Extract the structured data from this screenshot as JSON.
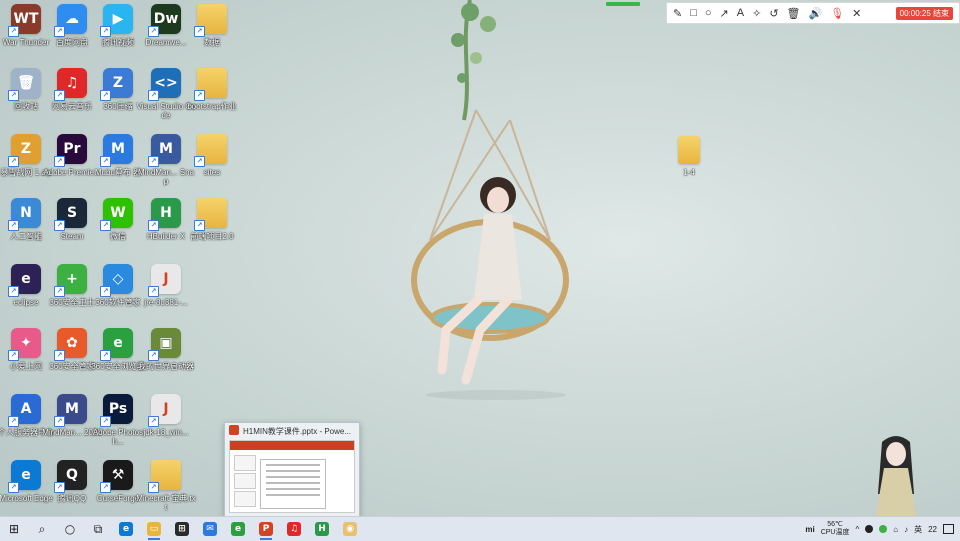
{
  "desktop": {
    "icons": [
      {
        "label": "War Thunder",
        "color": "#8a3a2a",
        "glyph": "WT"
      },
      {
        "label": "百度网盘",
        "color": "#2f8cf0",
        "glyph": "☁"
      },
      {
        "label": "腾讯视频",
        "color": "#2bb5f0",
        "glyph": "▶"
      },
      {
        "label": "Dreamwe...",
        "color": "#1e3a1e",
        "glyph": "Dw"
      },
      {
        "label": "数据",
        "color": "folder",
        "glyph": ""
      },
      {
        "label": "回收站",
        "color": "#9fb3c8",
        "glyph": "🗑"
      },
      {
        "label": "网易云音乐",
        "color": "#e02828",
        "glyph": "♫"
      },
      {
        "label": "360压缩",
        "color": "#3b7bd5",
        "glyph": "Z"
      },
      {
        "label": "Visual Studio Code",
        "color": "#1f6fb8",
        "glyph": "<>"
      },
      {
        "label": "bootstrap作业",
        "color": "folder",
        "glyph": ""
      },
      {
        "label": "暴雪战网 1.zip",
        "color": "#e0a030",
        "glyph": "Z"
      },
      {
        "label": "Adobe Premie...",
        "color": "#2a0a3a",
        "glyph": "Pr"
      },
      {
        "label": "Mubu幕布 器",
        "color": "#2a7ae0",
        "glyph": "M"
      },
      {
        "label": "MindMan... Snap",
        "color": "#3a5aa0",
        "glyph": "M"
      },
      {
        "label": "sites",
        "color": "folder",
        "glyph": ""
      },
      {
        "label": "人工智能",
        "color": "#3a8ad5",
        "glyph": "N"
      },
      {
        "label": "Steam",
        "color": "#1b2838",
        "glyph": "S"
      },
      {
        "label": "微信",
        "color": "#2ec100",
        "glyph": "W"
      },
      {
        "label": "HBuilder X",
        "color": "#2a9a4a",
        "glyph": "H"
      },
      {
        "label": "前端项目2.0",
        "color": "folder",
        "glyph": ""
      },
      {
        "label": "eclipse",
        "color": "#2c2255",
        "glyph": "e"
      },
      {
        "label": "360安全卫士",
        "color": "#3cb043",
        "glyph": "+"
      },
      {
        "label": "360软件管家",
        "color": "#2a8ae0",
        "glyph": "◇"
      },
      {
        "label": "jre-8u381-...",
        "color": "#e8e8e8",
        "glyph": "J"
      },
      {
        "label": "小爱上网",
        "color": "#e85a8a",
        "glyph": "✦"
      },
      {
        "label": "360安全管家",
        "color": "#e85a2a",
        "glyph": "✿"
      },
      {
        "label": "360安全浏览器",
        "color": "#2aa040",
        "glyph": "e"
      },
      {
        "label": "我的世界启动器",
        "color": "#6a8a3a",
        "glyph": "▣"
      },
      {
        "label": "个人服务器中心",
        "color": "#2a6ad5",
        "glyph": "A"
      },
      {
        "label": "MindMan... 2020",
        "color": "#3a4a8a",
        "glyph": "M"
      },
      {
        "label": "Adobe Photosh...",
        "color": "#0a1a3a",
        "glyph": "Ps"
      },
      {
        "label": "jdk-18_win...",
        "color": "#e8e8e8",
        "glyph": "J"
      },
      {
        "label": "Microsoft Edge",
        "color": "#0a7ad5",
        "glyph": "e"
      },
      {
        "label": "腾讯QQ",
        "color": "#222222",
        "glyph": "Q"
      },
      {
        "label": "CurseForge",
        "color": "#1a1a1a",
        "glyph": "⚒"
      },
      {
        "label": "Minecraft 宝典.txt",
        "color": "folder",
        "glyph": ""
      }
    ],
    "loose_file": {
      "label": "1-4"
    }
  },
  "recorder": {
    "tools": [
      "✎",
      "□",
      "○",
      "↗",
      "A",
      "✧",
      "↺",
      "🗑",
      "🔊",
      "🎙",
      "✕"
    ],
    "timer_label": "00:00:25 结束"
  },
  "preview": {
    "title": "H1MIN教学课件.pptx - Powe..."
  },
  "taskbar": {
    "start_glyph": "⊞",
    "search_glyph": "⌕",
    "cortana_glyph": "○",
    "taskview_glyph": "⧉",
    "apps": [
      {
        "name": "edge",
        "color": "#0a7ad5",
        "glyph": "e"
      },
      {
        "name": "file-explorer",
        "color": "#e8b53e",
        "glyph": "▭"
      },
      {
        "name": "store",
        "color": "#2a2a2a",
        "glyph": "⊞"
      },
      {
        "name": "mail",
        "color": "#2a7ae0",
        "glyph": "✉"
      },
      {
        "name": "360-browser",
        "color": "#2aa040",
        "glyph": "e"
      },
      {
        "name": "powerpoint",
        "color": "#d04423",
        "glyph": "P"
      },
      {
        "name": "netease-music",
        "color": "#e02828",
        "glyph": "♫"
      },
      {
        "name": "hbuilder",
        "color": "#2a9a4a",
        "glyph": "H"
      },
      {
        "name": "screen-recorder",
        "color": "#e8c070",
        "glyph": "◉"
      }
    ],
    "tray": {
      "brand": "mi",
      "temp": "56℃",
      "cpu_label": "CPU温度",
      "ime": "英",
      "clock": "22"
    }
  }
}
